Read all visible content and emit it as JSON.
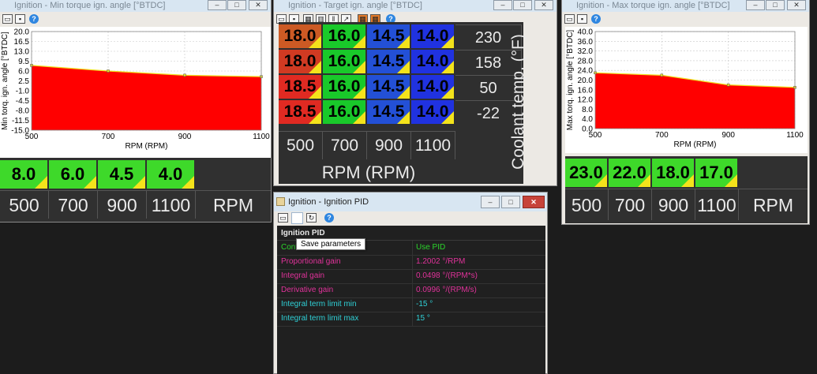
{
  "min_torque": {
    "title": "Ignition - Min torque ign. angle [°BTDC]",
    "ylabel": "Min torq. ign. angle [°BTDC]",
    "xlabel": "RPM (RPM)",
    "chart_data": {
      "type": "area",
      "x": [
        500,
        700,
        900,
        1100
      ],
      "values": [
        8.0,
        6.0,
        4.5,
        4.0
      ],
      "yticks": [
        "20.0",
        "16.5",
        "13.0",
        "9.5",
        "6.0",
        "2.5",
        "-1.0",
        "-4.5",
        "-8.0",
        "-11.5",
        "-15.0"
      ],
      "xticks": [
        "500",
        "700",
        "900",
        "1100"
      ],
      "ylim": [
        -15,
        20
      ],
      "xlim": [
        500,
        1100
      ],
      "xlabel": "RPM (RPM)",
      "ylabel": "Min torq. ign. angle [°BTDC]",
      "fill_color": "#ff0000",
      "grid": true
    },
    "table": {
      "values": [
        "8.0",
        "6.0",
        "4.5",
        "4.0"
      ],
      "rpm": [
        "500",
        "700",
        "900",
        "1100"
      ],
      "axis_label": "RPM"
    }
  },
  "target": {
    "title": "Ignition - Target ign. angle [°BTDC]",
    "rows": [
      {
        "temp": "230",
        "cells": [
          "18.0",
          "16.0",
          "14.5",
          "14.0"
        ],
        "colors": [
          "#cc5a24",
          "#19c92a",
          "#2350d6",
          "#2032e0"
        ]
      },
      {
        "temp": "158",
        "cells": [
          "18.0",
          "16.0",
          "14.5",
          "14.0"
        ],
        "colors": [
          "#d03a22",
          "#19c92a",
          "#2350d6",
          "#2032e0"
        ]
      },
      {
        "temp": "50",
        "cells": [
          "18.5",
          "16.0",
          "14.5",
          "14.0"
        ],
        "colors": [
          "#e02a22",
          "#19c92a",
          "#2350d6",
          "#2032e0"
        ]
      },
      {
        "temp": "-22",
        "cells": [
          "18.5",
          "16.0",
          "14.5",
          "14.0"
        ],
        "colors": [
          "#e02a22",
          "#19c92a",
          "#2350d6",
          "#2032e0"
        ]
      }
    ],
    "rpm": [
      "500",
      "700",
      "900",
      "1100"
    ],
    "col_axis_label": "RPM (RPM)",
    "row_axis_label": "Coolant temp. (°F)"
  },
  "max_torque": {
    "title": "Ignition - Max torque ign. angle [°BTDC]",
    "ylabel": "Max torq. ign. angle [°BTDC]",
    "xlabel": "RPM (RPM)",
    "chart_data": {
      "type": "area",
      "x": [
        500,
        700,
        900,
        1100
      ],
      "values": [
        23.0,
        22.0,
        18.0,
        17.0
      ],
      "yticks": [
        "40.0",
        "36.0",
        "32.0",
        "28.0",
        "24.0",
        "20.0",
        "16.0",
        "12.0",
        "8.0",
        "4.0",
        "0.0"
      ],
      "xticks": [
        "500",
        "700",
        "900",
        "1100"
      ],
      "ylim": [
        0,
        40
      ],
      "xlim": [
        500,
        1100
      ],
      "xlabel": "RPM (RPM)",
      "ylabel": "Max torq. ign. angle [°BTDC]",
      "fill_color": "#ff0000",
      "grid": true
    },
    "table": {
      "values": [
        "23.0",
        "22.0",
        "18.0",
        "17.0"
      ],
      "rpm": [
        "500",
        "700",
        "900",
        "1100"
      ],
      "axis_label": "RPM"
    }
  },
  "pid": {
    "title": "Ignition - Ignition PID",
    "header": "Ignition PID",
    "tooltip": "Save parameters",
    "rows": [
      {
        "key": "Cont",
        "value": "Use PID",
        "key_color": "#2bd42b",
        "value_color": "#2bd42b"
      },
      {
        "key": "Proportional gain",
        "value": "1.2002 °/RPM",
        "key_color": "#e0329a",
        "value_color": "#e0329a"
      },
      {
        "key": "Integral gain",
        "value": "0.0498 °/(RPM*s)",
        "key_color": "#e0329a",
        "value_color": "#e0329a"
      },
      {
        "key": "Derivative gain",
        "value": "0.0996 °/(RPM/s)",
        "key_color": "#e0329a",
        "value_color": "#e0329a"
      },
      {
        "key": "Integral term limit min",
        "value": "-15 °",
        "key_color": "#2fd0d6",
        "value_color": "#2fd0d6"
      },
      {
        "key": "Integral term limit max",
        "value": "15 °",
        "key_color": "#2fd0d6",
        "value_color": "#2fd0d6"
      }
    ]
  },
  "icons": {
    "open": "folder-open-icon",
    "save": "save-icon",
    "help": "help-icon",
    "grid": "table-icon",
    "chart": "chart-icon"
  },
  "colors": {
    "green_cell": "#3ed92a",
    "yellow_corner": "#f4e31b",
    "chart_fill": "#ff0000"
  }
}
